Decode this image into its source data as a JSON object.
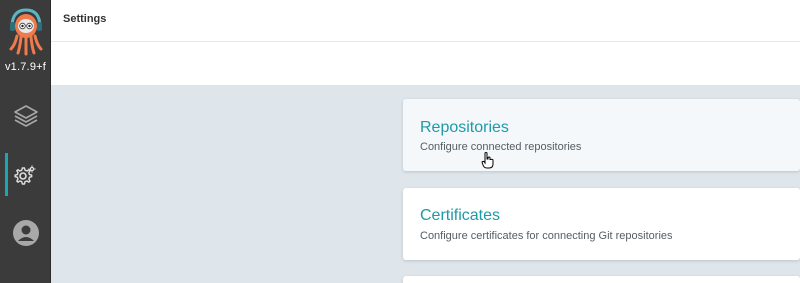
{
  "sidebar": {
    "version": "v1.7.9+f",
    "items": [
      {
        "icon": "layers-icon"
      },
      {
        "icon": "gear-icon"
      },
      {
        "icon": "user-icon"
      }
    ]
  },
  "header": {
    "title": "Settings"
  },
  "cards": [
    {
      "title": "Repositories",
      "description": "Configure connected repositories"
    },
    {
      "title": "Certificates",
      "description": "Configure certificates for connecting Git repositories"
    }
  ],
  "colors": {
    "sidebar_bg": "#3b3b3b",
    "accent": "#19a6b5",
    "card_title": "#1e9aa8",
    "content_bg": "#dee6eb"
  }
}
